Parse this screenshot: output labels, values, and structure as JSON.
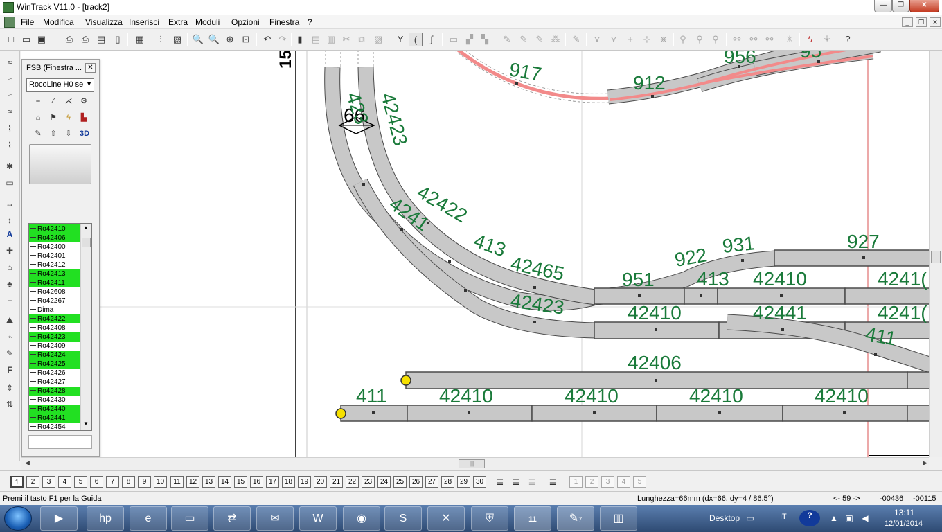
{
  "window": {
    "title": "WinTrack  V11.0 - [track2]"
  },
  "menu": [
    "File",
    "Modifica",
    "Visualizza",
    "Inserisci",
    "Extra",
    "Moduli",
    "Opzioni",
    "Finestra",
    "?"
  ],
  "fsb": {
    "title": "FSB (Finestra ...",
    "library": "RocoLine H0 se",
    "tool_3d": "3D",
    "list": [
      {
        "label": "Ro42410",
        "highlight": true
      },
      {
        "label": "Ro42406",
        "highlight": true
      },
      {
        "label": "Ro42400",
        "highlight": false
      },
      {
        "label": "Ro42401",
        "highlight": false
      },
      {
        "label": "Ro42412",
        "highlight": false
      },
      {
        "label": "Ro42413",
        "highlight": true
      },
      {
        "label": "Ro42411",
        "highlight": true
      },
      {
        "label": "Ro42608",
        "highlight": false
      },
      {
        "label": "Ro42267",
        "highlight": false
      },
      {
        "label": "Dima",
        "highlight": false
      },
      {
        "label": "Ro42422",
        "highlight": true
      },
      {
        "label": "Ro42408",
        "highlight": false
      },
      {
        "label": "Ro42423",
        "highlight": true
      },
      {
        "label": "Ro42409",
        "highlight": false
      },
      {
        "label": "Ro42424",
        "highlight": true
      },
      {
        "label": "Ro42425",
        "highlight": true
      },
      {
        "label": "Ro42426",
        "highlight": false
      },
      {
        "label": "Ro42427",
        "highlight": false
      },
      {
        "label": "Ro42428",
        "highlight": true
      },
      {
        "label": "Ro42430",
        "highlight": false
      },
      {
        "label": "Ro42440",
        "highlight": true
      },
      {
        "label": "Ro42441",
        "highlight": true
      },
      {
        "label": "Ro42454",
        "highlight": false
      }
    ]
  },
  "canvas": {
    "ruler_label": "15",
    "measure_label": "66",
    "track_labels": {
      "l917": "917",
      "l912": "912",
      "l956": "956",
      "l95x": "95",
      "l42423a": "42423",
      "l42423b": "423",
      "l42422": "42422",
      "l4241x": "4241",
      "l413a": "413",
      "l42465": "42465",
      "l951": "951",
      "l922": "922",
      "l931": "931",
      "l927": "927",
      "l42410a": "42410",
      "l42410b": "4241(",
      "l413b": "413",
      "l42423c": "42423",
      "l42410c": "42410",
      "l42441": "42441",
      "l42410d": "4241(",
      "l411a": "411",
      "l42406": "42406",
      "l411b": "411",
      "l42410e": "42410",
      "l42410f": "42410",
      "l42410g": "42410",
      "l42410h": "42410"
    }
  },
  "layers": {
    "numbers": [
      "1",
      "2",
      "3",
      "4",
      "5",
      "6",
      "7",
      "8",
      "9",
      "10",
      "11",
      "12",
      "13",
      "14",
      "15",
      "16",
      "17",
      "18",
      "19",
      "20",
      "21",
      "22",
      "23",
      "24",
      "25",
      "26",
      "27",
      "28",
      "29",
      "30"
    ],
    "extra": [
      "1",
      "2",
      "3",
      "4",
      "5"
    ]
  },
  "status": {
    "help": "Premi il tasto F1 per la Guida",
    "length": "Lunghezza=66mm (dx=66, dy=4 / 86.5°)",
    "nav": "<- 59 ->",
    "x": "-00436",
    "y": "-00115"
  },
  "taskbar": {
    "desktop": "Desktop",
    "lang": "IT",
    "time": "13:11",
    "date": "12/01/2014",
    "paint_count": "7",
    "wintrack_badge": "11"
  }
}
